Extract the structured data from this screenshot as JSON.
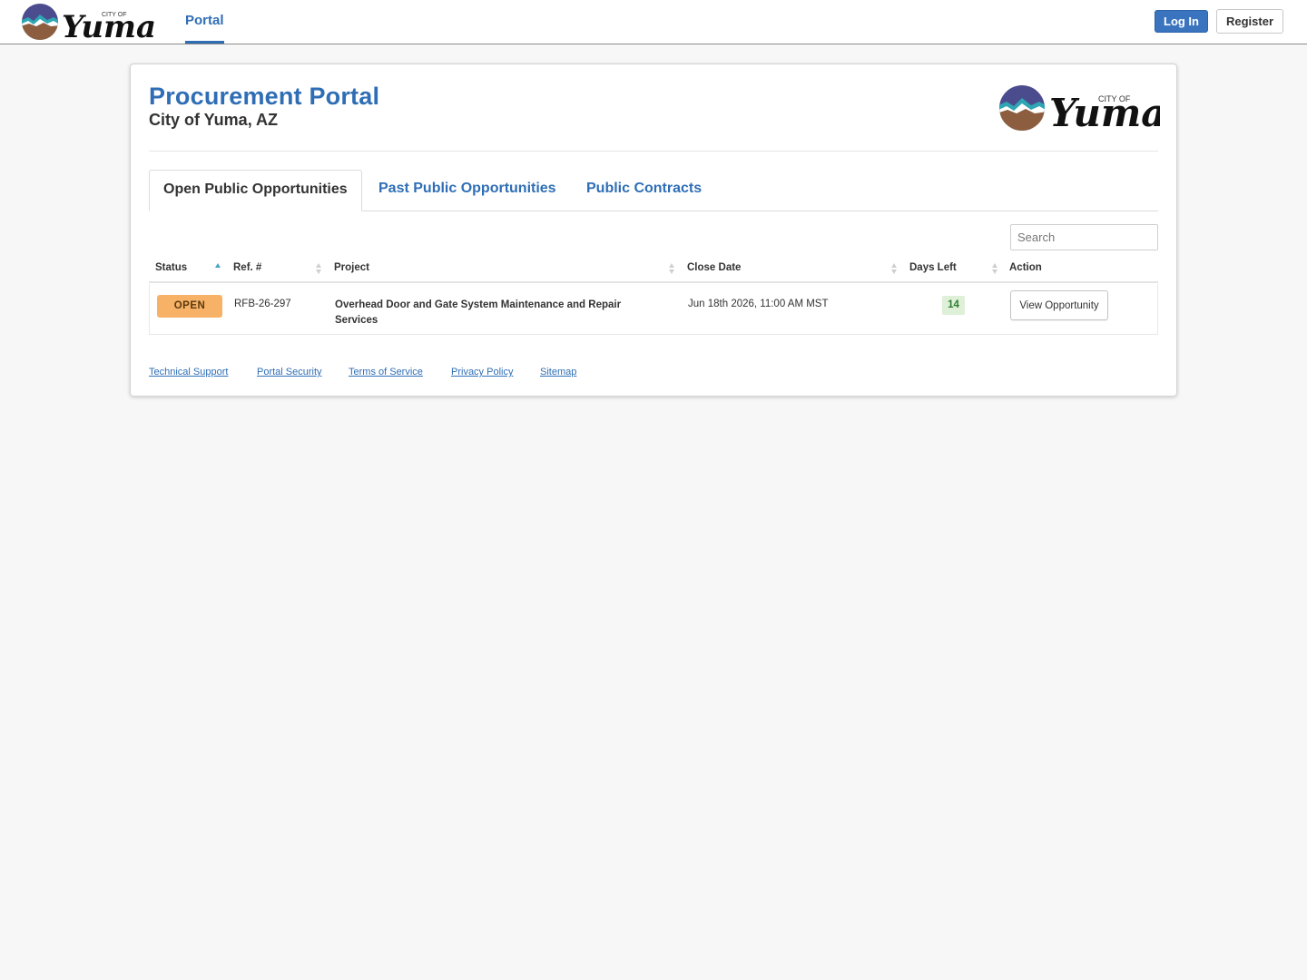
{
  "topbar": {
    "logo": {
      "small_text": "CITY OF",
      "script_text": "Yuma"
    },
    "nav_portal": "Portal",
    "login_label": "Log In",
    "register_label": "Register"
  },
  "header": {
    "title": "Procurement Portal",
    "subtitle": "City of Yuma, AZ",
    "logo": {
      "small_text": "CITY OF",
      "script_text": "Yuma"
    }
  },
  "tabs": [
    {
      "label": "Open Public Opportunities",
      "active": true
    },
    {
      "label": "Past Public Opportunities",
      "active": false
    },
    {
      "label": "Public Contracts",
      "active": false
    }
  ],
  "search": {
    "placeholder": "Search",
    "value": ""
  },
  "table": {
    "columns": [
      "Status",
      "Ref. #",
      "Project",
      "Close Date",
      "Days Left",
      "Action"
    ],
    "rows": [
      {
        "status": "OPEN",
        "ref": "RFB-26-297",
        "project": "Overhead Door and Gate System Maintenance and Repair Services",
        "close_date": "Jun 18th 2026, 11:00 AM MST",
        "days_left": "14",
        "action": "View Opportunity"
      }
    ]
  },
  "footer": {
    "links": [
      "Technical Support",
      "Portal Security",
      "Terms of Service",
      "Privacy Policy",
      "Sitemap"
    ]
  },
  "colors": {
    "brand_blue": "#2f6eb5",
    "login_button": "#3a74bf",
    "status_open": "#f7b267",
    "days_left_bg": "#dff0d8",
    "page_bg": "#f7f7f7"
  }
}
